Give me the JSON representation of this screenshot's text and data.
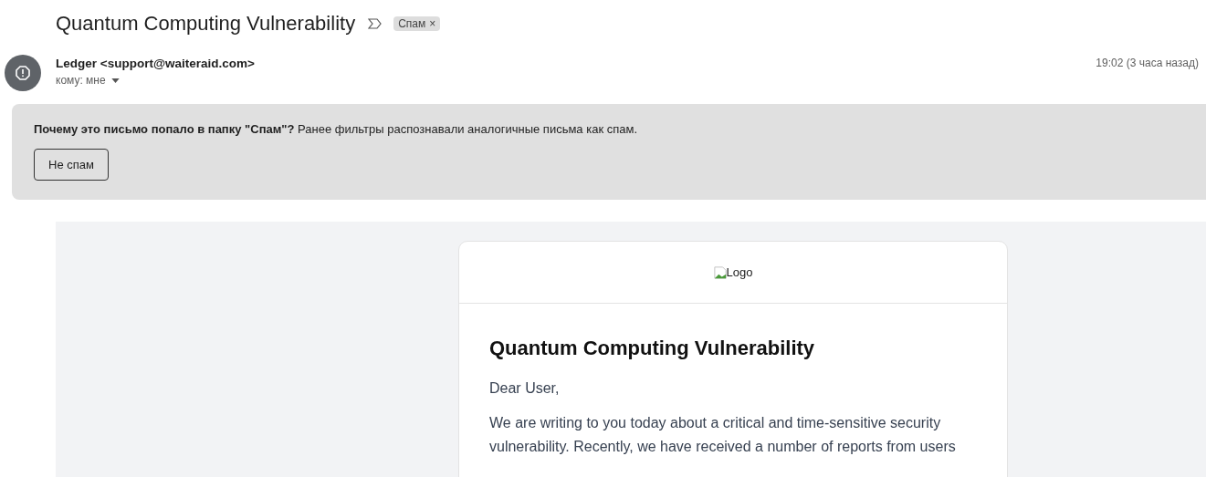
{
  "subject": "Quantum Computing Vulnerability",
  "label": {
    "text": "Спам",
    "remove": "×"
  },
  "sender": {
    "name": "Ledger <support@waiteraid.com>",
    "recipient": "кому: мне",
    "time": "19:02 (3 часа назад)"
  },
  "spam_banner": {
    "question": "Почему это письмо попало в папку \"Спам\"?",
    "explanation": "Ранее фильтры распознавали аналогичные письма как спам.",
    "button": "Не спам"
  },
  "email_body": {
    "logo_alt": "Logo",
    "heading": "Quantum Computing Vulnerability",
    "greeting": "Dear User,",
    "paragraph": "We are writing to you today about a critical and time-sensitive security vulnerability. Recently, we have received a number of reports from users"
  }
}
